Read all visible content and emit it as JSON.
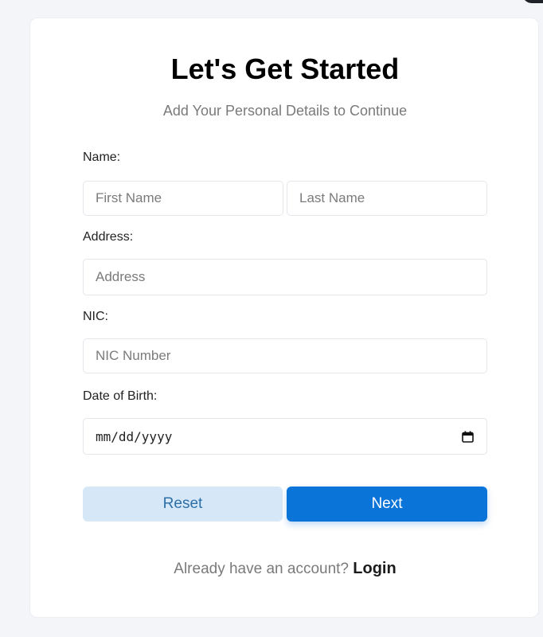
{
  "header": {
    "title": "Let's Get Started",
    "subtitle": "Add Your Personal Details to Continue"
  },
  "form": {
    "name_label": "Name:",
    "first_name_placeholder": "First Name",
    "last_name_placeholder": "Last Name",
    "address_label": "Address:",
    "address_placeholder": "Address",
    "nic_label": "NIC:",
    "nic_placeholder": "NIC Number",
    "dob_label": "Date of Birth:",
    "dob_placeholder": "mm/dd/yyyy",
    "dob_icon": "calendar-icon"
  },
  "actions": {
    "reset_label": "Reset",
    "next_label": "Next"
  },
  "footer": {
    "prompt": "Already have an account?",
    "login_label": "Login"
  },
  "colors": {
    "primary": "#0b74d9",
    "secondary_bg": "#d6e8f8",
    "secondary_text": "#2d6fa8",
    "page_bg": "#f4f5f9"
  }
}
